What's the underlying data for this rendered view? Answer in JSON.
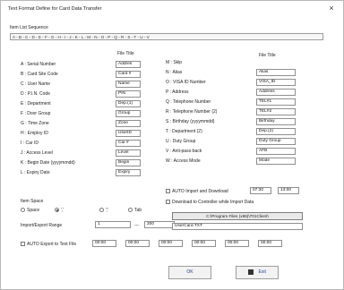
{
  "dialog": {
    "title": "Text Format Define for Card Data Transfer",
    "close": "×"
  },
  "sequence": {
    "label": "Item List Sequence",
    "text": "A - B - C - D - E - F - G - H - I - J - K - L - M - N - O - P - Q - R - S - T - U - V"
  },
  "headers": {
    "file_title_left": "File Title",
    "file_title_right": "File Title"
  },
  "left_items": [
    {
      "label": "A : Serial Number",
      "value": "Addres"
    },
    {
      "label": "B : Card Site Code",
      "value": "Card #"
    },
    {
      "label": "C : User Name",
      "value": "Name"
    },
    {
      "label": "D : P.I.N. Code",
      "value": "PIN"
    },
    {
      "label": "E : Department",
      "value": "Dep.(1)"
    },
    {
      "label": "F : Door Group",
      "value": "Group"
    },
    {
      "label": "G : Time Zone",
      "value": "Zone"
    },
    {
      "label": "H : Employ ID",
      "value": "UserID"
    },
    {
      "label": "I : Car ID",
      "value": "Car #"
    },
    {
      "label": "J : Access Level",
      "value": "Level"
    },
    {
      "label": "K : Begin Date (yyyymmdd)",
      "value": "Begin"
    },
    {
      "label": "L : Expiry Date",
      "value": "Expiry"
    }
  ],
  "right_items": [
    {
      "label": "M : Skip",
      "value": ""
    },
    {
      "label": "N : Alias",
      "value": "Alias"
    },
    {
      "label": "O : VISA ID Number",
      "value": "VISA_ID"
    },
    {
      "label": "P : Address",
      "value": "Address"
    },
    {
      "label": "Q : Telephone Number",
      "value": "TEL#1"
    },
    {
      "label": "R : Telephone Number (2)",
      "value": "TEL#2"
    },
    {
      "label": "S : Birthday (yyyymmdd)",
      "value": "Birthday"
    },
    {
      "label": "T : Department (2)",
      "value": "Dep.(2)"
    },
    {
      "label": "U : Duty Group",
      "value": "Duty Group"
    },
    {
      "label": "V : Anti-pass-back",
      "value": "AFB"
    },
    {
      "label": "W : Access Mode",
      "value": "Mode"
    }
  ],
  "item_space": {
    "label": "Item Space",
    "options": [
      "Space",
      "','",
      "';'",
      "Tab"
    ],
    "selected_index": 1
  },
  "import_range": {
    "label": "Import/Export Range",
    "from": "1",
    "sep": "---",
    "to": "200"
  },
  "auto_import": {
    "label": "AUTO Import and Download",
    "time1": "07:30",
    "time2": "13:00"
  },
  "download_controller": {
    "label": "Download to Controller while Import Data"
  },
  "path": {
    "text": "C:\\Program Files (x86)\\701Client\\",
    "filename": "UserCard.TXT"
  },
  "auto_export": {
    "label": "AUTO Export to Text File",
    "times": [
      "00:00",
      "00:00",
      "00:00",
      "00:00",
      "00:00",
      "00:00"
    ]
  },
  "buttons": {
    "ok": "OK",
    "exit": "Exit"
  },
  "colors": {
    "link": "#1f3f8f",
    "border": "#8f8f8f"
  }
}
